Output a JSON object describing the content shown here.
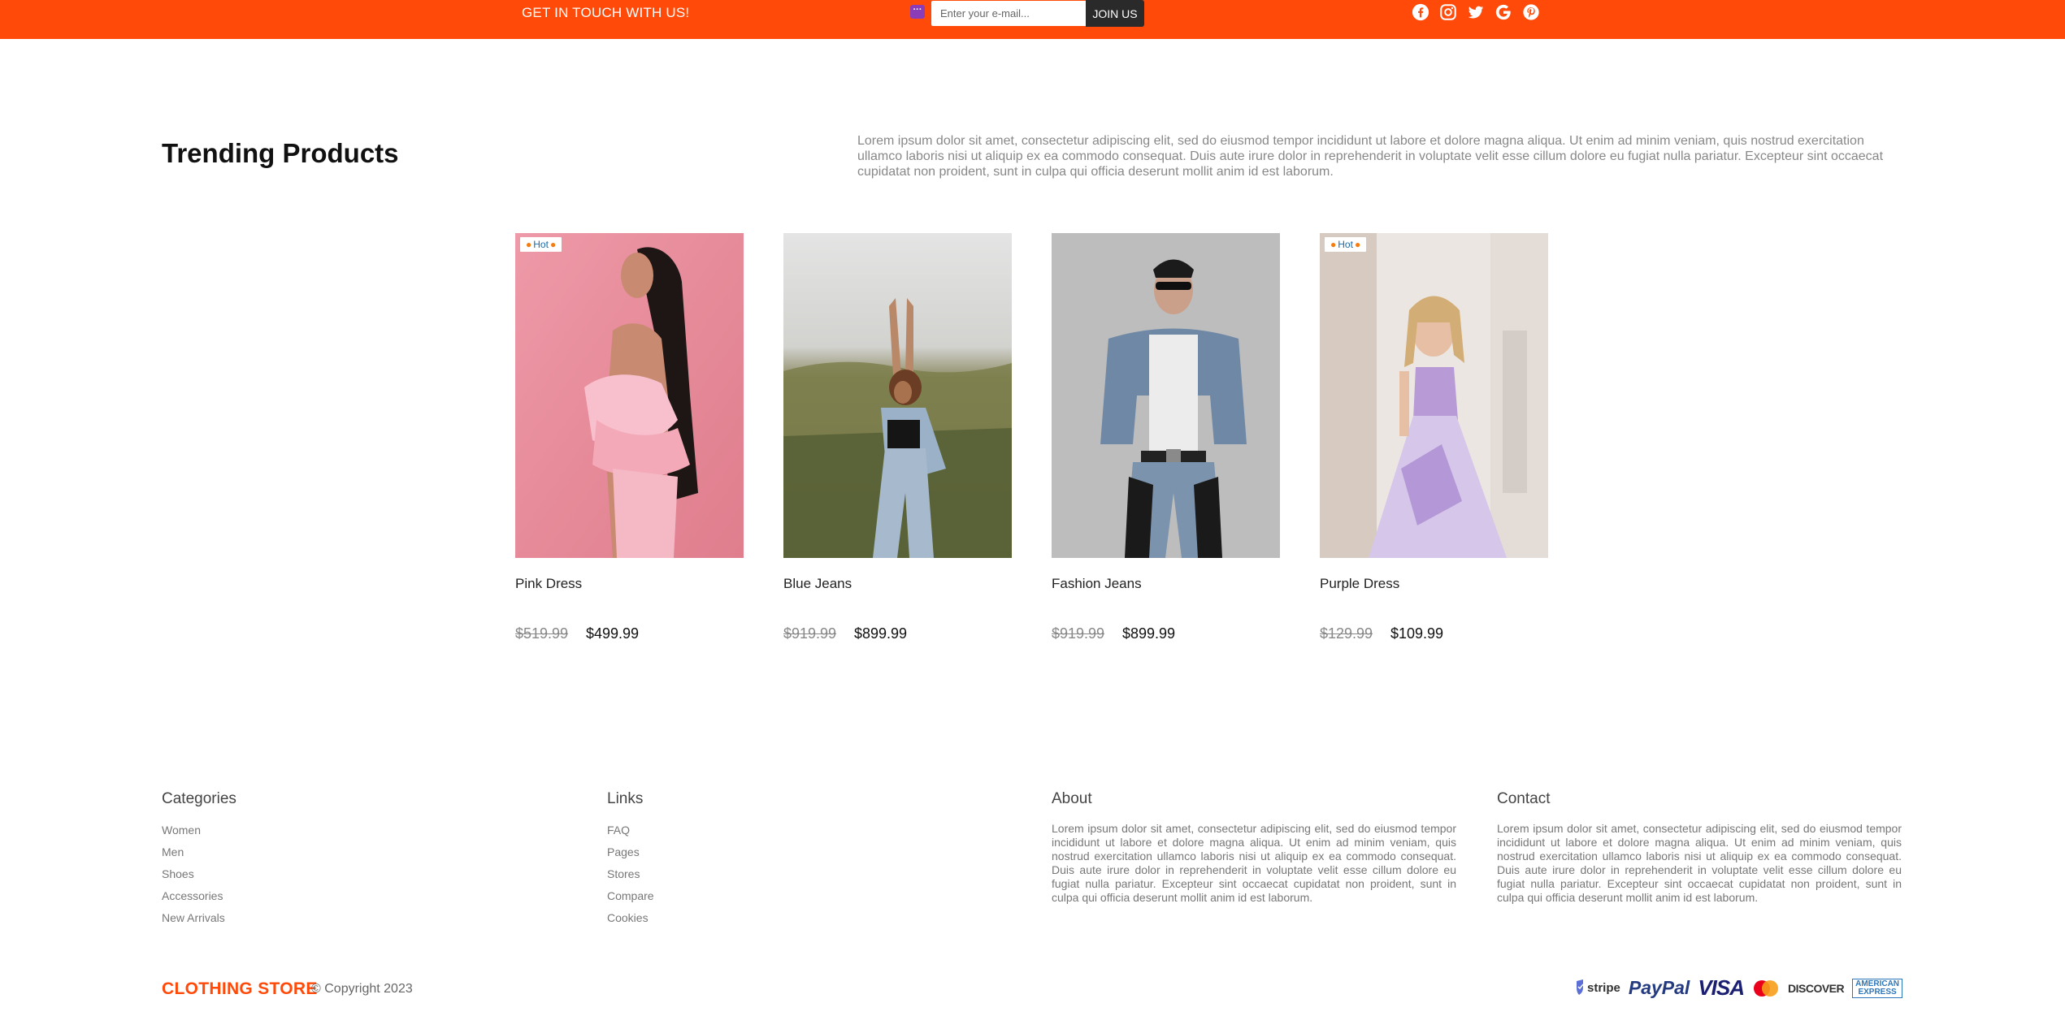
{
  "topbar": {
    "touch_text": "GET IN TOUCH WITH US!",
    "email_placeholder": "Enter your e-mail...",
    "join_label": "JOIN US",
    "social_icons": [
      "facebook-icon",
      "instagram-icon",
      "twitter-icon",
      "google-icon",
      "pinterest-icon"
    ],
    "background_color": "#ff4a0a"
  },
  "trending": {
    "title": "Trending Products",
    "description": "Lorem ipsum dolor sit amet, consectetur adipiscing elit, sed do eiusmod tempor incididunt ut labore et dolore magna aliqua. Ut enim ad minim veniam, quis nostrud exercitation ullamco laboris nisi ut aliquip ex ea commodo consequat. Duis aute irure dolor in reprehenderit in voluptate velit esse cillum dolore eu fugiat nulla pariatur. Excepteur sint occaecat cupidatat non proident, sunt in culpa qui officia deserunt mollit anim id est laborum."
  },
  "products": [
    {
      "name": "Pink Dress",
      "old_price": "$519.99",
      "price": "$499.99",
      "badge": "Hot"
    },
    {
      "name": "Blue Jeans",
      "old_price": "$919.99",
      "price": "$899.99",
      "badge": ""
    },
    {
      "name": "Fashion Jeans",
      "old_price": "$919.99",
      "price": "$899.99",
      "badge": ""
    },
    {
      "name": "Purple Dress",
      "old_price": "$129.99",
      "price": "$109.99",
      "badge": "Hot"
    }
  ],
  "footer": {
    "categories": {
      "title": "Categories",
      "items": [
        "Women",
        "Men",
        "Shoes",
        "Accessories",
        "New Arrivals"
      ]
    },
    "links": {
      "title": "Links",
      "items": [
        "FAQ",
        "Pages",
        "Stores",
        "Compare",
        "Cookies"
      ]
    },
    "about": {
      "title": "About",
      "text": "Lorem ipsum dolor sit amet, consectetur adipiscing elit, sed do eiusmod tempor incididunt ut labore et dolore magna aliqua. Ut enim ad minim veniam, quis nostrud exercitation ullamco laboris nisi ut aliquip ex ea commodo consequat. Duis aute irure dolor in reprehenderit in voluptate velit esse cillum dolore eu fugiat nulla pariatur. Excepteur sint occaecat cupidatat non proident, sunt in culpa qui officia deserunt mollit anim id est laborum."
    },
    "contact": {
      "title": "Contact",
      "text": "Lorem ipsum dolor sit amet, consectetur adipiscing elit, sed do eiusmod tempor incididunt ut labore et dolore magna aliqua. Ut enim ad minim veniam, quis nostrud exercitation ullamco laboris nisi ut aliquip ex ea commodo consequat. Duis aute irure dolor in reprehenderit in voluptate velit esse cillum dolore eu fugiat nulla pariatur. Excepteur sint occaecat cupidatat non proident, sunt in culpa qui officia deserunt mollit anim id est laborum."
    },
    "brand": "CLOTHING STORE",
    "copyright": "© Copyright 2023",
    "payment_logos": [
      "stripe-logo",
      "paypal-logo",
      "visa-logo",
      "mastercard-logo",
      "discover-logo",
      "american-express-logo"
    ],
    "payment_text": {
      "stripe": "stripe",
      "paypal": "PayPal",
      "visa": "VISA",
      "discover": "DISCOVER",
      "amex_line1": "AMERICAN",
      "amex_line2": "EXPRESS"
    }
  }
}
